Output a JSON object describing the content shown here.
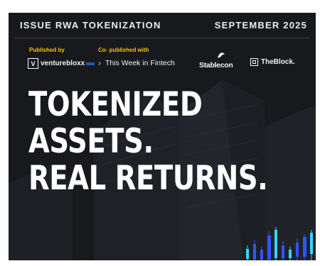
{
  "header": {
    "issue": "ISSUE RWA TOKENIZATION",
    "date": "SEPTEMBER 2025"
  },
  "publishers": {
    "published_by_label": "Published by",
    "published_by_name": "venturebloxx",
    "published_by_mark": "V",
    "co_published_label": "Co- published with",
    "partners": [
      "This Week in Fintech",
      "Stablecon",
      "TheBlock."
    ]
  },
  "headline": {
    "line1": "TOKENIZED",
    "line2": "ASSETS.",
    "line3": "REAL RETURNS."
  },
  "colors": {
    "background": "#17191c",
    "accent": "#f5c400",
    "candle_blue": "#2f55ff",
    "candle_cyan": "#35d6ff"
  }
}
